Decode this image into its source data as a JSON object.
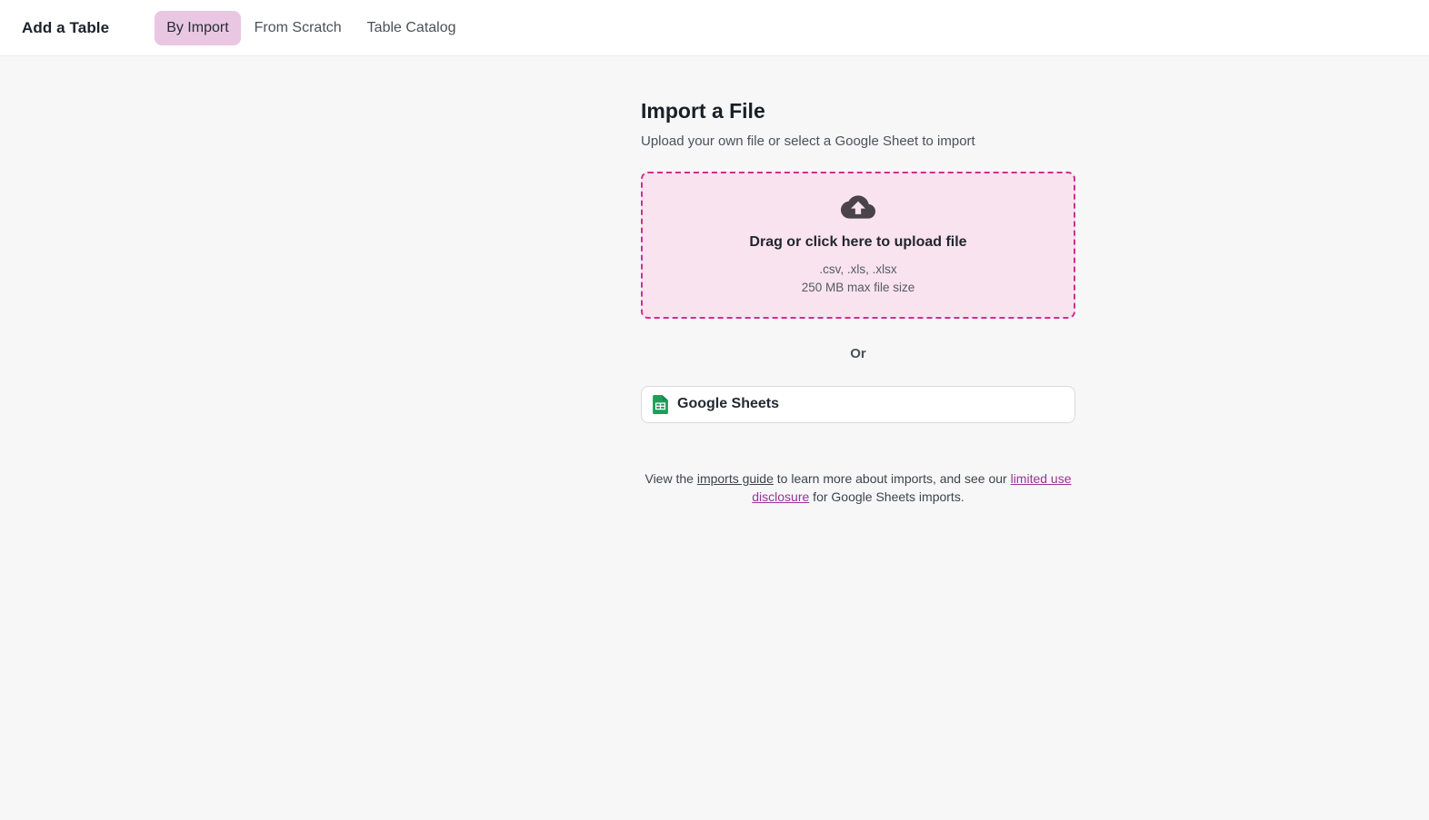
{
  "header": {
    "title": "Add a Table",
    "tabs": [
      {
        "label": "By Import",
        "active": true
      },
      {
        "label": "From Scratch",
        "active": false
      },
      {
        "label": "Table Catalog",
        "active": false
      }
    ]
  },
  "main": {
    "heading": "Import a File",
    "subheading": "Upload your own file or select a Google Sheet to import",
    "dropzone": {
      "icon": "cloud-upload-icon",
      "title": "Drag or click here to upload file",
      "formats": ".csv, .xls, .xlsx",
      "max_size": "250 MB max file size"
    },
    "divider_label": "Or",
    "google_sheets_button": {
      "icon": "google-sheets-icon",
      "label": "Google Sheets"
    },
    "footer": {
      "prefix": "View the ",
      "imports_guide_link": "imports guide",
      "middle": " to learn more about imports, and see our ",
      "disclosure_link": "limited use disclosure",
      "suffix": " for Google Sheets imports."
    }
  },
  "colors": {
    "accent_magenta": "#ce2f91",
    "active_tab_bg": "#e9c7e3",
    "dropzone_bg": "#f9e3ef",
    "link_purple": "#9c3296",
    "sheets_green": "#1d9e59",
    "cloud_icon_gray": "#4a4349",
    "page_bg": "#f7f7f8"
  }
}
